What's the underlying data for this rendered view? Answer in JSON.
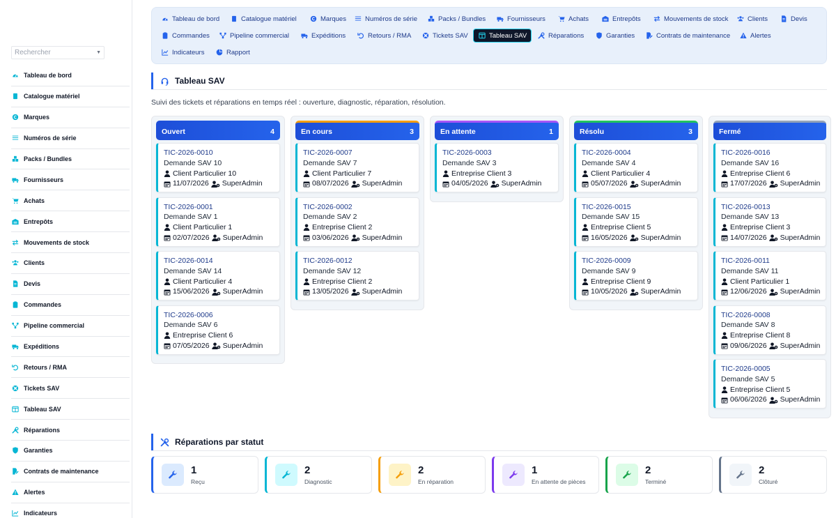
{
  "sidebar": {
    "search_placeholder": "Rechercher",
    "items": [
      {
        "label": "Tableau de bord",
        "icon": "gauge-icon"
      },
      {
        "label": "Catalogue matériel",
        "icon": "book-icon"
      },
      {
        "label": "Marques",
        "icon": "copyright-icon"
      },
      {
        "label": "Numéros de série",
        "icon": "barcode-icon"
      },
      {
        "label": "Packs / Bundles",
        "icon": "cubes-icon"
      },
      {
        "label": "Fournisseurs",
        "icon": "truck-icon"
      },
      {
        "label": "Achats",
        "icon": "cart-icon"
      },
      {
        "label": "Entrepôts",
        "icon": "warehouse-icon"
      },
      {
        "label": "Mouvements de stock",
        "icon": "arrows-icon"
      },
      {
        "label": "Clients",
        "icon": "users-icon"
      },
      {
        "label": "Devis",
        "icon": "file-icon"
      },
      {
        "label": "Commandes",
        "icon": "clipboard-icon"
      },
      {
        "label": "Pipeline commercial",
        "icon": "diagram-icon"
      },
      {
        "label": "Expéditions",
        "icon": "shipping-icon"
      },
      {
        "label": "Retours / RMA",
        "icon": "undo-icon"
      },
      {
        "label": "Tickets SAV",
        "icon": "lifebuoy-icon"
      },
      {
        "label": "Tableau SAV",
        "icon": "columns-icon"
      },
      {
        "label": "Réparations",
        "icon": "tools-icon"
      },
      {
        "label": "Garanties",
        "icon": "shield-icon"
      },
      {
        "label": "Contrats de maintenance",
        "icon": "contract-icon"
      },
      {
        "label": "Alertes",
        "icon": "warning-icon"
      },
      {
        "label": "Indicateurs",
        "icon": "chart-icon"
      }
    ]
  },
  "topnav": {
    "items": [
      {
        "label": "Tableau de bord",
        "icon": "gauge-icon"
      },
      {
        "label": "Catalogue matériel",
        "icon": "book-icon"
      },
      {
        "label": "Marques",
        "icon": "copyright-icon"
      },
      {
        "label": "Numéros de série",
        "icon": "barcode-icon"
      },
      {
        "label": "Packs / Bundles",
        "icon": "cubes-icon"
      },
      {
        "label": "Fournisseurs",
        "icon": "truck-icon"
      },
      {
        "label": "Achats",
        "icon": "cart-icon"
      },
      {
        "label": "Entrepôts",
        "icon": "warehouse-icon"
      },
      {
        "label": "Mouvements de stock",
        "icon": "arrows-icon"
      },
      {
        "label": "Clients",
        "icon": "users-icon"
      },
      {
        "label": "Devis",
        "icon": "file-icon"
      },
      {
        "label": "Commandes",
        "icon": "clipboard-icon"
      },
      {
        "label": "Pipeline commercial",
        "icon": "diagram-icon"
      },
      {
        "label": "Expéditions",
        "icon": "shipping-icon"
      },
      {
        "label": "Retours / RMA",
        "icon": "undo-icon"
      },
      {
        "label": "Tickets SAV",
        "icon": "lifebuoy-icon"
      },
      {
        "label": "Tableau SAV",
        "icon": "columns-icon",
        "active": true
      },
      {
        "label": "Réparations",
        "icon": "tools-icon"
      },
      {
        "label": "Garanties",
        "icon": "shield-icon"
      },
      {
        "label": "Contrats de maintenance",
        "icon": "contract-icon"
      },
      {
        "label": "Alertes",
        "icon": "warning-icon"
      },
      {
        "label": "Indicateurs",
        "icon": "chart-icon"
      },
      {
        "label": "Rapport",
        "icon": "pie-icon"
      }
    ]
  },
  "page": {
    "title": "Tableau SAV",
    "subtitle": "Suivi des tickets et réparations en temps réel : ouverture, diagnostic, réparation, résolution."
  },
  "board": {
    "columns": [
      {
        "title": "Ouvert",
        "count": "4",
        "cards": [
          {
            "ref": "TIC-2026-0010",
            "subject": "Demande SAV 10",
            "client": "Client Particulier 10",
            "date": "11/07/2026",
            "agent": "SuperAdmin"
          },
          {
            "ref": "TIC-2026-0001",
            "subject": "Demande SAV 1",
            "client": "Client Particulier 1",
            "date": "02/07/2026",
            "agent": "SuperAdmin"
          },
          {
            "ref": "TIC-2026-0014",
            "subject": "Demande SAV 14",
            "client": "Client Particulier 4",
            "date": "15/06/2026",
            "agent": "SuperAdmin"
          },
          {
            "ref": "TIC-2026-0006",
            "subject": "Demande SAV 6",
            "client": "Entreprise Client 6",
            "date": "07/05/2026",
            "agent": "SuperAdmin"
          }
        ]
      },
      {
        "title": "En cours",
        "count": "3",
        "cards": [
          {
            "ref": "TIC-2026-0007",
            "subject": "Demande SAV 7",
            "client": "Client Particulier 7",
            "date": "08/07/2026",
            "agent": "SuperAdmin"
          },
          {
            "ref": "TIC-2026-0002",
            "subject": "Demande SAV 2",
            "client": "Entreprise Client 2",
            "date": "03/06/2026",
            "agent": "SuperAdmin"
          },
          {
            "ref": "TIC-2026-0012",
            "subject": "Demande SAV 12",
            "client": "Entreprise Client 2",
            "date": "13/05/2026",
            "agent": "SuperAdmin"
          }
        ]
      },
      {
        "title": "En attente",
        "count": "1",
        "cards": [
          {
            "ref": "TIC-2026-0003",
            "subject": "Demande SAV 3",
            "client": "Entreprise Client 3",
            "date": "04/05/2026",
            "agent": "SuperAdmin"
          }
        ]
      },
      {
        "title": "Résolu",
        "count": "3",
        "cards": [
          {
            "ref": "TIC-2026-0004",
            "subject": "Demande SAV 4",
            "client": "Client Particulier 4",
            "date": "05/07/2026",
            "agent": "SuperAdmin"
          },
          {
            "ref": "TIC-2026-0015",
            "subject": "Demande SAV 15",
            "client": "Entreprise Client 5",
            "date": "16/05/2026",
            "agent": "SuperAdmin"
          },
          {
            "ref": "TIC-2026-0009",
            "subject": "Demande SAV 9",
            "client": "Entreprise Client 9",
            "date": "10/05/2026",
            "agent": "SuperAdmin"
          }
        ]
      },
      {
        "title": "Fermé",
        "count": "",
        "cards": [
          {
            "ref": "TIC-2026-0016",
            "subject": "Demande SAV 16",
            "client": "Entreprise Client 6",
            "date": "17/07/2026",
            "agent": "SuperAdmin"
          },
          {
            "ref": "TIC-2026-0013",
            "subject": "Demande SAV 13",
            "client": "Entreprise Client 3",
            "date": "14/07/2026",
            "agent": "SuperAdmin"
          },
          {
            "ref": "TIC-2026-0011",
            "subject": "Demande SAV 11",
            "client": "Client Particulier 1",
            "date": "12/06/2026",
            "agent": "SuperAdmin"
          },
          {
            "ref": "TIC-2026-0008",
            "subject": "Demande SAV 8",
            "client": "Entreprise Client 8",
            "date": "09/06/2026",
            "agent": "SuperAdmin"
          },
          {
            "ref": "TIC-2026-0005",
            "subject": "Demande SAV 5",
            "client": "Entreprise Client 5",
            "date": "06/06/2026",
            "agent": "SuperAdmin"
          }
        ]
      }
    ]
  },
  "repairs": {
    "title": "Réparations par statut",
    "stats": [
      {
        "value": "1",
        "label": "Reçu",
        "color": "#2563eb",
        "bg": "#dbeafe"
      },
      {
        "value": "2",
        "label": "Diagnostic",
        "color": "#06b6d4",
        "bg": "#cffafe"
      },
      {
        "value": "2",
        "label": "En réparation",
        "color": "#f59e0b",
        "bg": "#fef3c7"
      },
      {
        "value": "1",
        "label": "En attente de pièces",
        "color": "#7c3aed",
        "bg": "#ede9fe"
      },
      {
        "value": "2",
        "label": "Terminé",
        "color": "#16a34a",
        "bg": "#dcfce7"
      },
      {
        "value": "2",
        "label": "Clôturé",
        "color": "#64748b",
        "bg": "#f1f5f9"
      }
    ]
  }
}
